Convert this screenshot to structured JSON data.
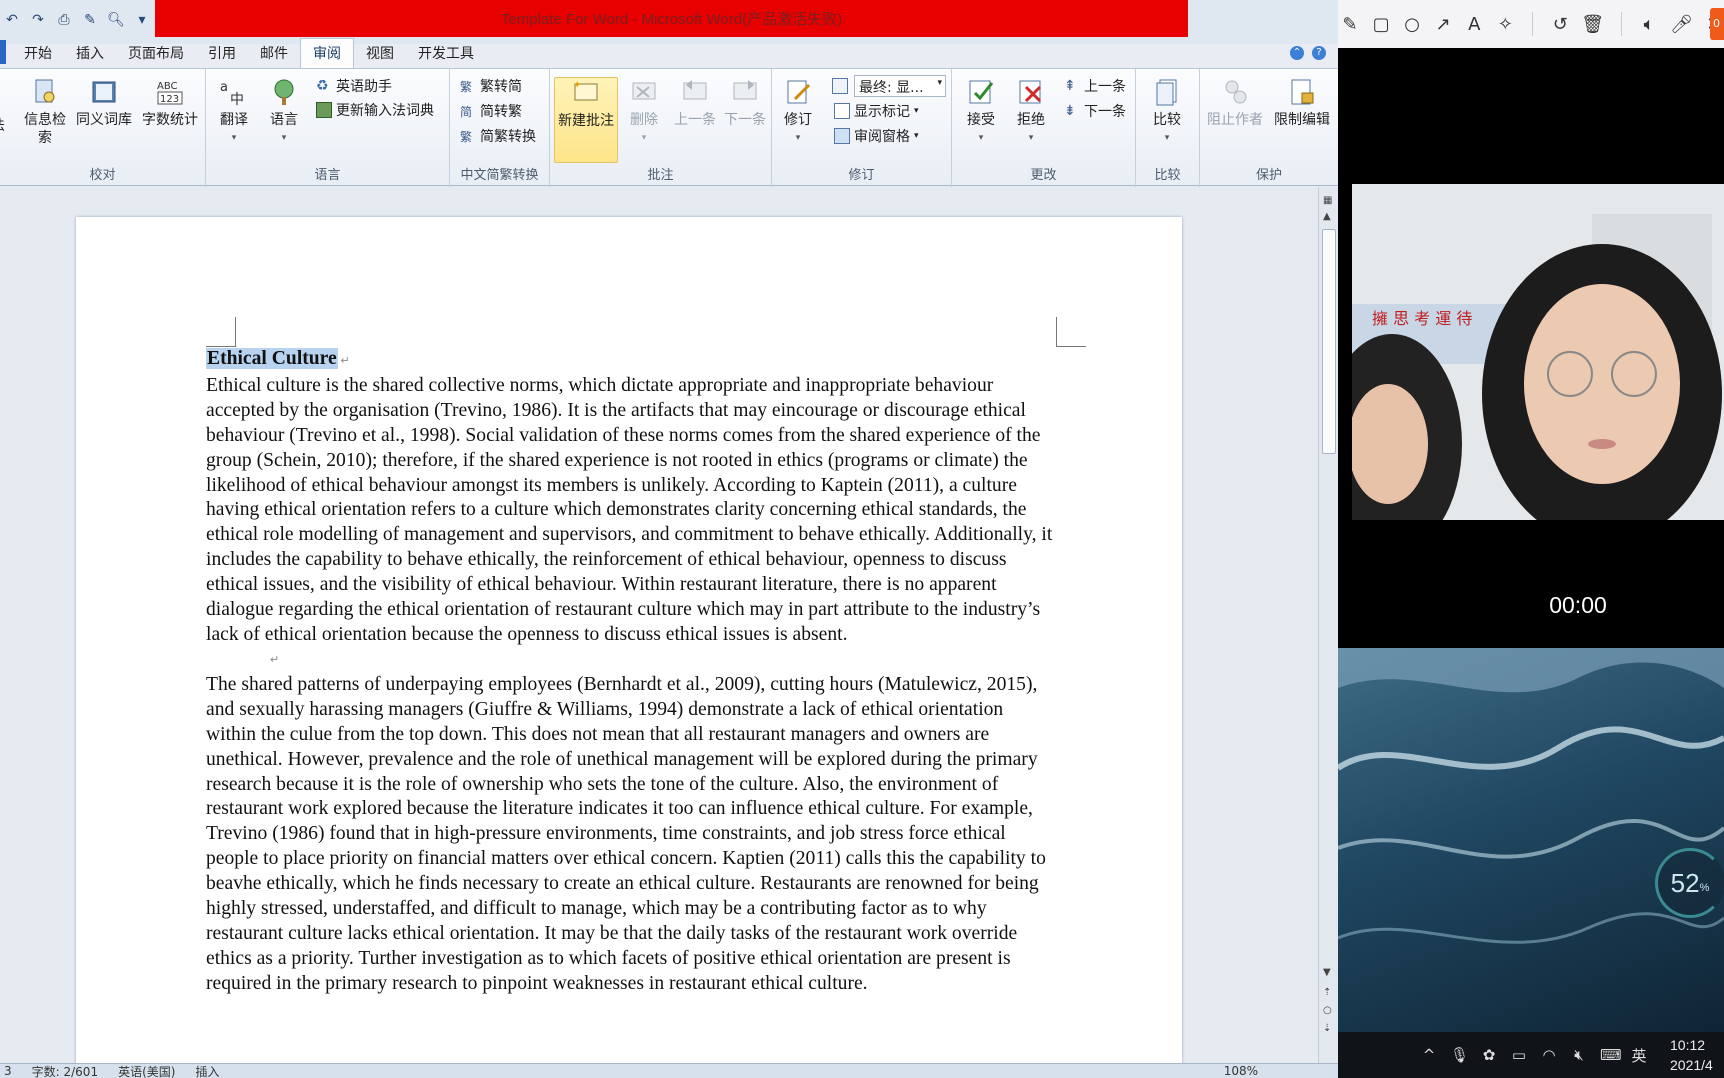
{
  "window": {
    "title": "Template For Word  -  Microsoft Word(产品激活失败)"
  },
  "quick_access": [
    "undo-icon",
    "redo-icon",
    "print-icon",
    "edit-icon",
    "preview-icon",
    "dropdown-icon"
  ],
  "tabs": [
    {
      "label": "开始",
      "active": false
    },
    {
      "label": "插入",
      "active": false
    },
    {
      "label": "页面布局",
      "active": false
    },
    {
      "label": "引用",
      "active": false
    },
    {
      "label": "邮件",
      "active": false
    },
    {
      "label": "审阅",
      "active": true
    },
    {
      "label": "视图",
      "active": false
    },
    {
      "label": "开发工具",
      "active": false
    }
  ],
  "ribbon": {
    "proofing": {
      "label": "校对",
      "partial_label": "法",
      "research": "信息检索",
      "thesaurus": "同义词库",
      "word_count": "字数统计"
    },
    "language": {
      "label": "语言",
      "translate": "翻译",
      "language": "语言",
      "english_assistant": "英语助手",
      "update_ime": "更新输入法词典"
    },
    "chinese_conversion": {
      "label": "中文简繁转换",
      "to_simplified": "繁转简",
      "to_traditional": "简转繁",
      "conversion": "简繁转换"
    },
    "comments": {
      "label": "批注",
      "new_comment": "新建批注",
      "delete": "删除",
      "previous": "上一条",
      "next": "下一条"
    },
    "tracking": {
      "label": "修订",
      "track_changes": "修订",
      "display_combo": "最终: 显...",
      "show_markup": "显示标记",
      "reviewing_pane": "审阅窗格"
    },
    "changes": {
      "label": "更改",
      "accept": "接受",
      "reject": "拒绝",
      "previous": "上一条",
      "next": "下一条"
    },
    "compare": {
      "label": "比较",
      "compare": "比较"
    },
    "protect": {
      "label": "保护",
      "block_authors": "阻止作者",
      "restrict_editing": "限制编辑"
    }
  },
  "document": {
    "heading": "Ethical Culture",
    "paragraph1": "Ethical culture is the shared collective norms, which dictate appropriate and inappropriate behaviour accepted by the organisation (Trevino, 1986).  It is the artifacts that may eincourage or discourage ethical behaviour (Trevino et al., 1998).  Social validation of these norms comes from the shared experience of the group (Schein, 2010); therefore, if the shared experience is not rooted in ethics (programs or climate) the likelihood of ethical behaviour amongst its members is unlikely.  According to Kaptein (2011), a culture having ethical orientation refers to a culture which demonstrates clarity concerning ethical standards, the ethical role modelling of management and supervisors, and commitment to behave ethically.  Additionally, it includes the capability to behave ethically, the reinforcement of ethical behaviour, openness to discuss ethical issues, and the visibility of ethical behaviour.   Within restaurant literature, there is no apparent dialogue regarding the ethical orientation of restaurant culture which may in part attribute to the industry’s lack of ethical orientation because the openness to discuss ethical issues is absent.",
    "paragraph2": "The shared patterns of underpaying employees (Bernhardt et al., 2009), cutting hours (Matulewicz, 2015), and sexually harassing managers (Giuffre & Williams, 1994) demonstrate a lack of ethical orientation within the culue from the top down.  This does not mean that all restaurant managers and owners are unethical.  However, prevalence and the role of unethical management will be explored during the primary research because it is the role of ownership who sets the tone of the culture.  Also, the environment of restaurant work explored because the literature indicates it too can influence ethical culture.  For example, Trevino (1986) found that in high-pressure environments, time constraints, and job stress force ethical people to place priority on financial matters over ethical concern.  Kaptien (2011) calls this the capability to beavhe ethically, which he finds necessary to create an ethical culture.  Restaurants are renowned for being highly stressed, understaffed, and difficult to manage, which may be a contributing factor as to why restaurant culture lacks ethical orientation.  It may be that the daily tasks of the restaurant work override ethics as a priority.  Turther investigation as to which facets of positive ethical orientation are present is required in the primary research to pinpoint weaknesses in restaurant ethical culture."
  },
  "statusbar": {
    "page": "3",
    "word_count": "字数: 2/601",
    "language": "英语(美国)",
    "mode": "插入",
    "zoom": "108%"
  },
  "overlay": {
    "tools": [
      "pencil-icon",
      "rectangle-icon",
      "circle-icon",
      "arrow-icon",
      "text-icon",
      "magic-wand-icon",
      "undo-icon",
      "trash-icon",
      "speaker-icon",
      "microphone-icon",
      "close-icon"
    ],
    "tab_label": "0",
    "timer": "00:00",
    "battery": "52",
    "battery_unit": "%"
  },
  "taskbar": {
    "ime": "英",
    "time": "10:12",
    "date": "2021/4"
  },
  "colors": {
    "title_red": "#e80000",
    "selection": "#b8d3f0",
    "spell_error": "#e04040",
    "grammar_error": "#3b9a3b"
  }
}
